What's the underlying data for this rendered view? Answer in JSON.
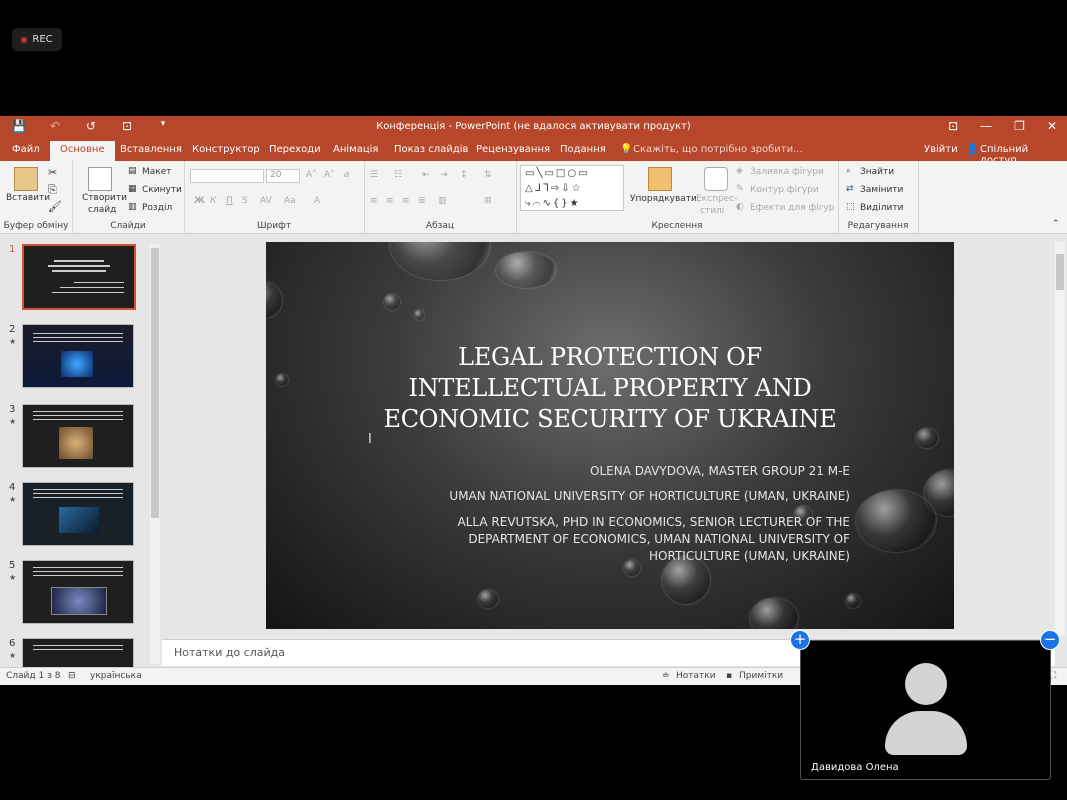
{
  "recorder": {
    "label": "REC"
  },
  "window": {
    "title": "Конференція - PowerPoint (не вдалося активувати продукт)"
  },
  "qat": {
    "save_icon": "💾",
    "undo_icon": "↶",
    "redo_icon": "↺",
    "present_icon": "⊡",
    "more_icon": "▾"
  },
  "winctrl": {
    "ribbon_icon": "⊡",
    "min_icon": "—",
    "max_icon": "❐",
    "close_icon": "✕"
  },
  "ribbon_tabs": [
    {
      "label": "Файл"
    },
    {
      "label": "Основне"
    },
    {
      "label": "Вставлення"
    },
    {
      "label": "Конструктор"
    },
    {
      "label": "Переходи"
    },
    {
      "label": "Анімація"
    },
    {
      "label": "Показ слайдів"
    },
    {
      "label": "Рецензування"
    },
    {
      "label": "Подання"
    }
  ],
  "tell_me": {
    "placeholder": "Скажіть, що потрібно зробити..."
  },
  "account": {
    "signin": "Увійти",
    "share": "Спільний доступ"
  },
  "ribbon": {
    "clipboard": {
      "paste": "Вставити",
      "group": "Буфер обміну"
    },
    "slides": {
      "new_slide_line1": "Створити",
      "new_slide_line2": "слайд",
      "layout": "Макет",
      "reset": "Скинути",
      "section": "Розділ",
      "group": "Слайди"
    },
    "font": {
      "size": "20",
      "bold": "Ж",
      "italic": "К",
      "underline": "П",
      "strike": "S",
      "group": "Шрифт"
    },
    "paragraph": {
      "group": "Абзац"
    },
    "drawing": {
      "arrange": "Упорядкувати",
      "quick_line1": "Експрес-",
      "quick_line2": "стилі",
      "fill": "Заливка фігури",
      "outline": "Контур фігури",
      "effects": "Ефекти для фігур",
      "group": "Креслення"
    },
    "editing": {
      "find": "Знайти",
      "replace": "Замінити",
      "select": "Виділити",
      "group": "Редагування"
    }
  },
  "thumbnails": [
    {
      "num": "1",
      "star": ""
    },
    {
      "num": "2",
      "star": "★"
    },
    {
      "num": "3",
      "star": "★"
    },
    {
      "num": "4",
      "star": "★"
    },
    {
      "num": "5",
      "star": "★"
    },
    {
      "num": "6",
      "star": "★"
    }
  ],
  "slide": {
    "title_line1": "LEGAL PROTECTION OF",
    "title_line2": "INTELLECTUAL PROPERTY AND",
    "title_line3": "ECONOMIC SECURITY OF UKRAINE",
    "line1": "OLENA DAVYDOVA, MASTER GROUP 21 M-E",
    "line2": "UMAN NATIONAL UNIVERSITY OF HORTICULTURE (UMAN, UKRAINE)",
    "line3": "ALLA REVUTSKA, PHD IN ECONOMICS, SENIOR LECTURER OF THE DEPARTMENT OF ECONOMICS, UMAN NATIONAL UNIVERSITY OF HORTICULTURE (UMAN, UKRAINE)"
  },
  "notes": {
    "placeholder": "Нотатки до слайда"
  },
  "status": {
    "slide": "Слайд 1 з 8",
    "language": "українська",
    "notes": "Нотатки",
    "comments": "Примітки"
  },
  "video": {
    "name": "Давидова Олена",
    "add_icon": "+",
    "remove_icon": "−"
  }
}
